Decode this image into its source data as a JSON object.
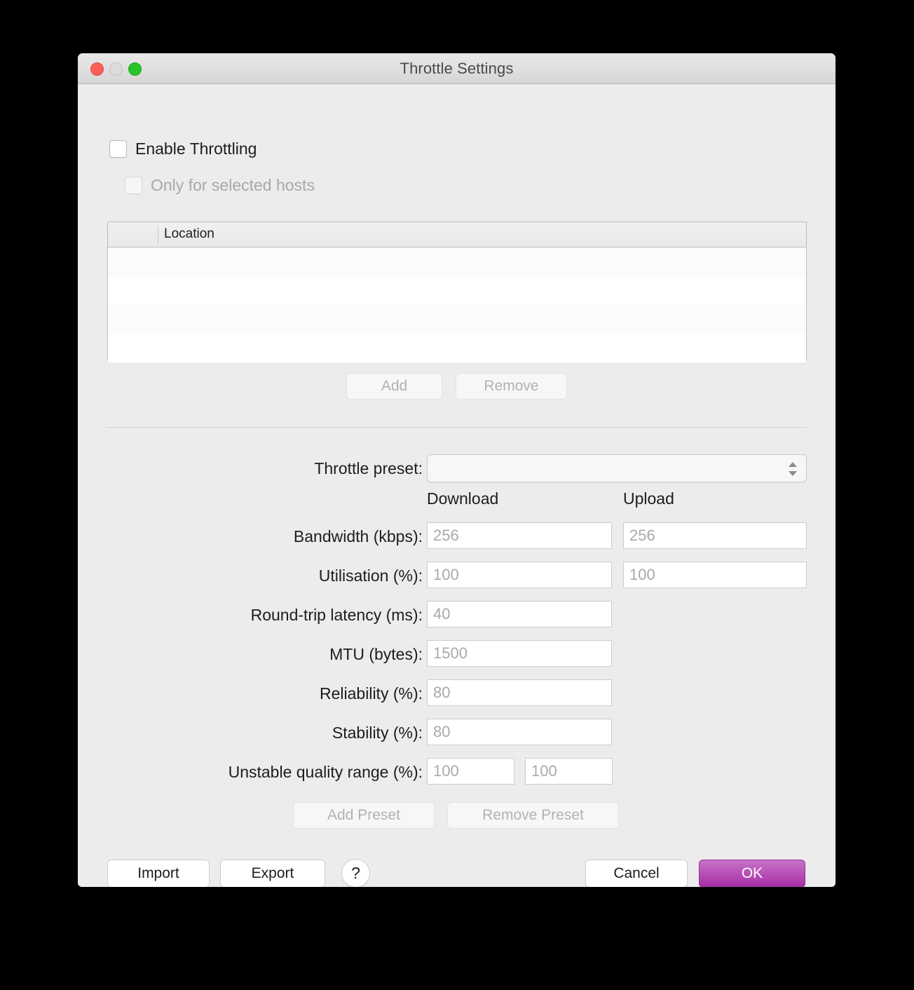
{
  "window": {
    "title": "Throttle Settings",
    "traffic_lights": [
      "close-button",
      "minimize-button",
      "zoom-button"
    ]
  },
  "options": {
    "enable_throttling": {
      "label": "Enable Throttling",
      "checked": false,
      "enabled": true
    },
    "only_selected_hosts": {
      "label": "Only for selected hosts",
      "checked": false,
      "enabled": false
    }
  },
  "hosts_table": {
    "columns": [
      "Location"
    ],
    "rows": [],
    "row_count": 4
  },
  "host_buttons": {
    "add": {
      "label": "Add",
      "enabled": false
    },
    "remove": {
      "label": "Remove",
      "enabled": false
    }
  },
  "preset": {
    "label": "Throttle preset:",
    "value": "",
    "placeholder": "",
    "stepper_icon": "chevron-up-down-icon"
  },
  "columns": {
    "download": "Download",
    "upload": "Upload"
  },
  "fields": {
    "bandwidth": {
      "label": "Bandwidth (kbps):",
      "download": "",
      "download_placeholder": "256",
      "upload": "",
      "upload_placeholder": "256"
    },
    "utilisation": {
      "label": "Utilisation (%):",
      "download": "",
      "download_placeholder": "100",
      "upload": "",
      "upload_placeholder": "100"
    },
    "latency": {
      "label": "Round-trip latency (ms):",
      "download": "",
      "download_placeholder": "40"
    },
    "mtu": {
      "label": "MTU (bytes):",
      "download": "",
      "download_placeholder": "1500"
    },
    "reliability": {
      "label": "Reliability (%):",
      "download": "",
      "download_placeholder": "80"
    },
    "stability": {
      "label": "Stability (%):",
      "download": "",
      "download_placeholder": "80"
    },
    "unstable": {
      "label": "Unstable quality range (%):",
      "min": "",
      "min_placeholder": "100",
      "max": "",
      "max_placeholder": "100"
    }
  },
  "preset_buttons": {
    "add": {
      "label": "Add Preset",
      "enabled": false
    },
    "remove": {
      "label": "Remove Preset",
      "enabled": false
    }
  },
  "footer": {
    "import": "Import",
    "export": "Export",
    "help": "?",
    "cancel": "Cancel",
    "ok": "OK"
  },
  "colors": {
    "window_background": "#ececec",
    "titlebar_top": "#e9e9e9",
    "titlebar_bottom": "#d6d6d6",
    "default_button_top": "#c472c4",
    "default_button_bottom": "#a62ea6",
    "close_light": "#fc5f57",
    "minimize_light": "#dcdcdc",
    "zoom_light": "#2ac32a",
    "disabled_text": "#b2b2b2",
    "placeholder_text": "#a9a9a9"
  }
}
